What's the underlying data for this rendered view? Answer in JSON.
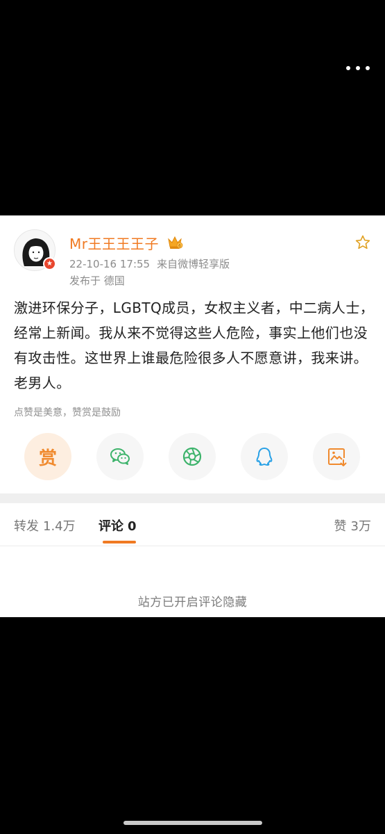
{
  "post": {
    "username": "Mr王王王王子",
    "time": "22-10-16 17:55",
    "source": "来自微博轻享版",
    "location": "发布于 德国",
    "text": "激进环保分子，LGBTQ成员，女权主义者，中二病人士，经常上新闻。我从来不觉得这些人危险，事实上他们也没有攻击性。这世界上谁最危险很多人不愿意讲，我来讲。老男人。",
    "reward_hint": "点赞是美意，赞赏是鼓励"
  },
  "actions": {
    "reward_label": "赏",
    "icons": [
      "reward-icon",
      "wechat-icon",
      "moments-icon",
      "qq-icon",
      "save-image-icon"
    ]
  },
  "tabs": {
    "repost_label": "转发",
    "repost_count": "1.4万",
    "comment_label": "评论",
    "comment_count": "0",
    "like_label": "赞",
    "like_count": "3万"
  },
  "comments": {
    "notice": "站方已开启评论隐藏"
  },
  "colors": {
    "accent": "#f07a22",
    "background": "#000000",
    "card": "#ffffff"
  }
}
